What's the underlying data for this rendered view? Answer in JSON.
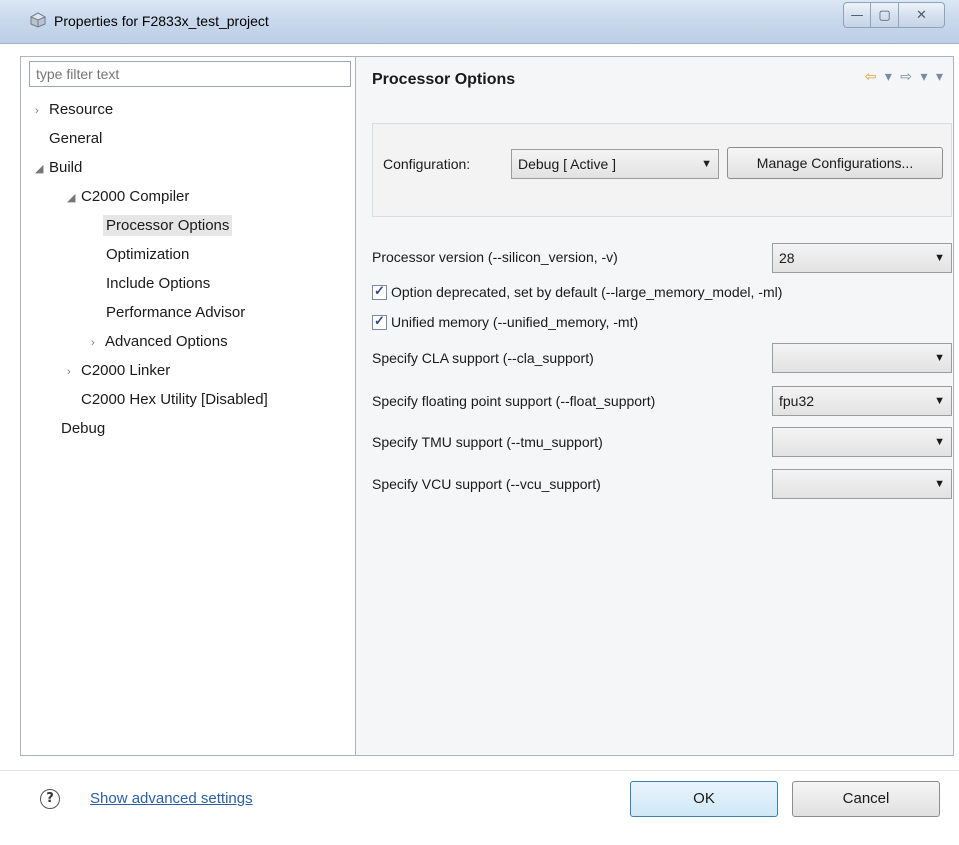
{
  "window": {
    "title": "Properties for F2833x_test_project",
    "buttons": {
      "minimize": "—",
      "maximize": "▢",
      "close": "✕"
    }
  },
  "left_panel": {
    "filter_placeholder": "type filter text",
    "tree": [
      {
        "label": "Resource",
        "arrow": "›",
        "level": 0
      },
      {
        "label": "General",
        "arrow": "",
        "level": 0
      },
      {
        "label": "Build",
        "arrow": "◢",
        "level": 0
      },
      {
        "label": "C2000 Compiler",
        "arrow": "◢",
        "level": 1
      },
      {
        "label": "Processor Options",
        "arrow": "",
        "level": 2,
        "selected": true
      },
      {
        "label": "Optimization",
        "arrow": "",
        "level": 2
      },
      {
        "label": "Include Options",
        "arrow": "",
        "level": 2
      },
      {
        "label": "Performance Advisor",
        "arrow": "",
        "level": 2
      },
      {
        "label": "Advanced Options",
        "arrow": "›",
        "level": 2
      },
      {
        "label": "C2000 Linker",
        "arrow": "›",
        "level": 1
      },
      {
        "label": "C2000 Hex Utility  [Disabled]",
        "arrow": "",
        "level": 1
      },
      {
        "label": "Debug",
        "arrow": "",
        "level": 0
      }
    ]
  },
  "right_panel": {
    "title": "Processor Options",
    "nav": {
      "back": "⇦",
      "back_menu": "▾",
      "forward": "⇨",
      "forward_menu": "▾",
      "view_menu": "▾"
    },
    "configuration": {
      "label": "Configuration:",
      "value": "Debug  [ Active ]",
      "manage_button": "Manage Configurations..."
    },
    "options": [
      {
        "label": "Processor version (--silicon_version, -v)",
        "type": "combo",
        "value": "28"
      },
      {
        "label": "Option deprecated, set by default (--large_memory_model, -ml)",
        "type": "checkbox",
        "checked": true
      },
      {
        "label": "Unified memory (--unified_memory, -mt)",
        "type": "checkbox",
        "checked": true
      },
      {
        "label": "Specify CLA support (--cla_support)",
        "type": "combo",
        "value": ""
      },
      {
        "label": "Specify floating point support (--float_support)",
        "type": "combo",
        "value": "fpu32"
      },
      {
        "label": "Specify TMU support (--tmu_support)",
        "type": "combo",
        "value": ""
      },
      {
        "label": "Specify VCU support (--vcu_support)",
        "type": "combo",
        "value": ""
      }
    ]
  },
  "footer": {
    "help_icon": "?",
    "advanced_link": "Show advanced settings",
    "ok": "OK",
    "cancel": "Cancel"
  },
  "colors": {
    "link": "#2a5fa8",
    "ok_border": "#3c7fb1",
    "titlebar": "#c9d9ec"
  }
}
